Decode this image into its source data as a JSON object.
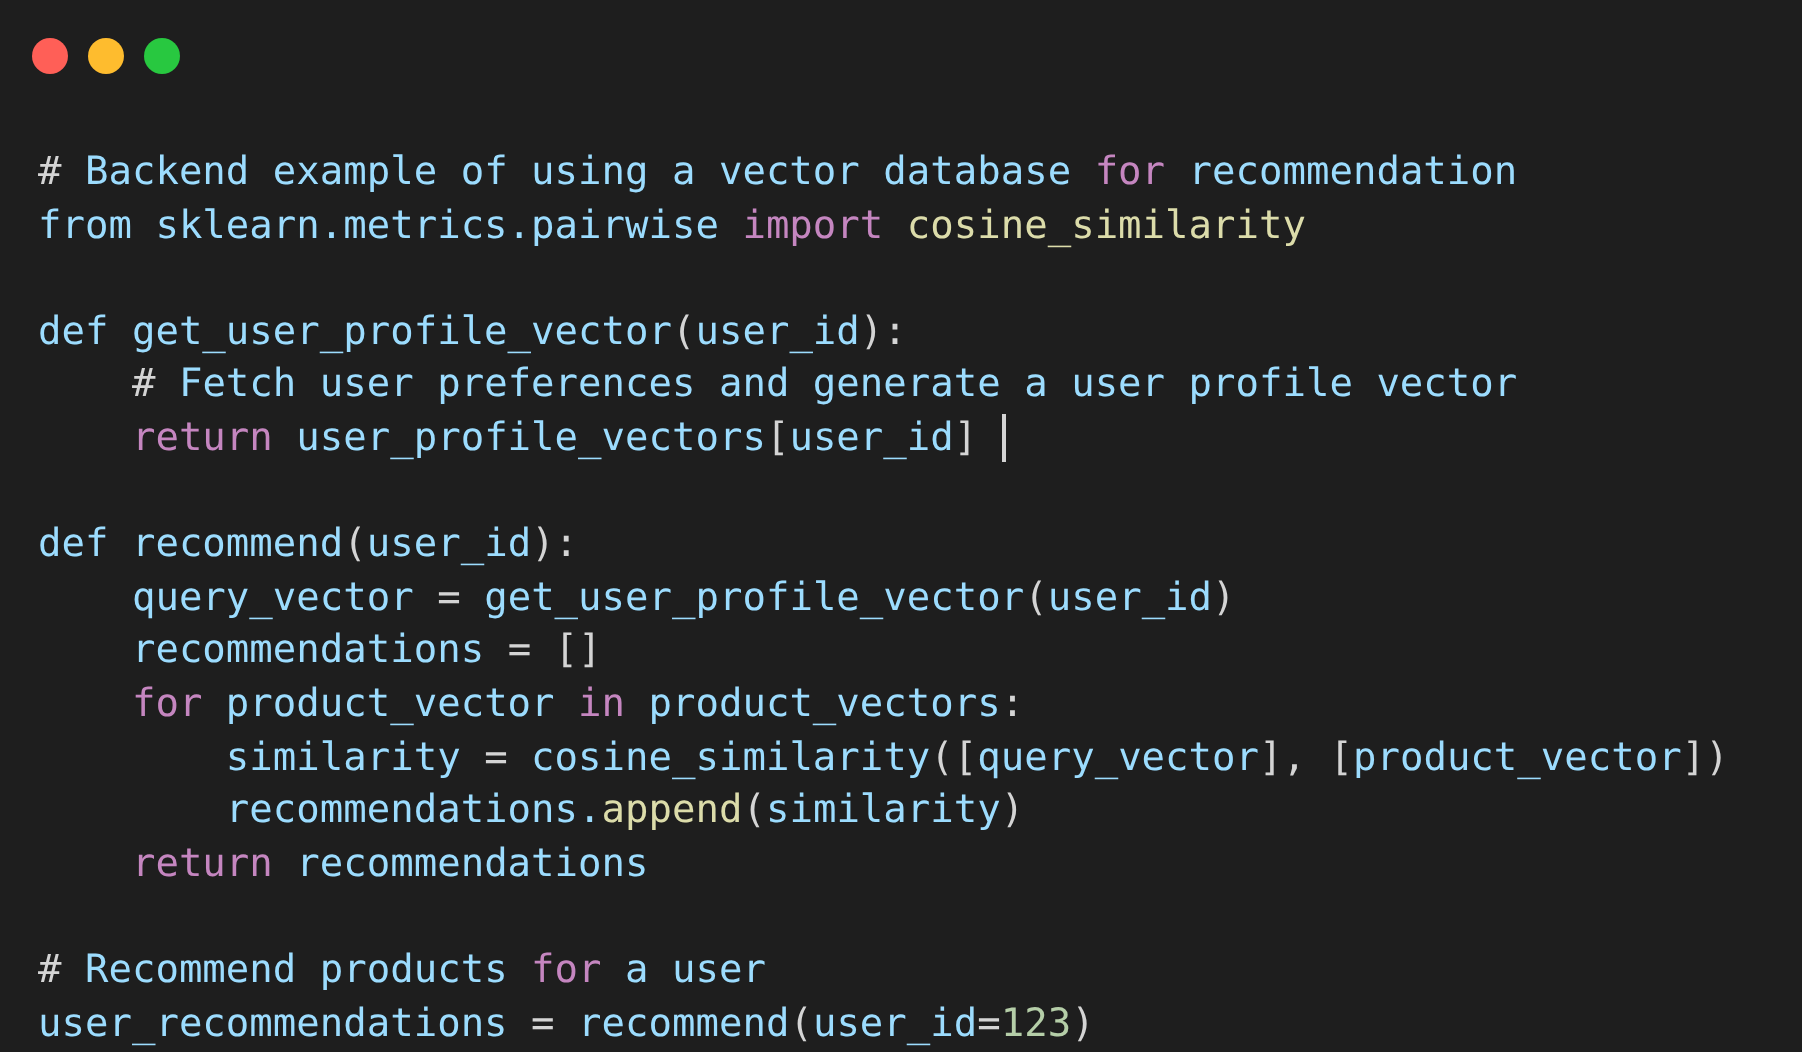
{
  "window_controls": [
    {
      "kind": "close"
    },
    {
      "kind": "minimize"
    },
    {
      "kind": "maximize"
    }
  ],
  "code_lines": [
    {
      "kind": "code",
      "tokens": [
        {
          "kind": "punct",
          "text": "# "
        },
        {
          "kind": "plain",
          "text": "Backend example of using a vector database "
        },
        {
          "kind": "keyword",
          "text": "for"
        },
        {
          "kind": "plain",
          "text": " recommendation"
        }
      ]
    },
    {
      "kind": "code",
      "tokens": [
        {
          "kind": "plain",
          "text": "from sklearn.metrics.pairwise "
        },
        {
          "kind": "keyword",
          "text": "import"
        },
        {
          "kind": "func",
          "text": " cosine_similarity"
        }
      ]
    },
    {
      "kind": "blank"
    },
    {
      "kind": "code",
      "tokens": [
        {
          "kind": "plain",
          "text": "def get_user_profile_vector"
        },
        {
          "kind": "punct",
          "text": "("
        },
        {
          "kind": "plain",
          "text": "user_id"
        },
        {
          "kind": "punct",
          "text": "):"
        }
      ]
    },
    {
      "kind": "code",
      "tokens": [
        {
          "kind": "punct",
          "text": "    # "
        },
        {
          "kind": "plain",
          "text": "Fetch user preferences and generate a user profile vector"
        }
      ]
    },
    {
      "kind": "code",
      "cursor": true,
      "tokens": [
        {
          "kind": "keyword",
          "text": "    return"
        },
        {
          "kind": "plain",
          "text": " user_profile_vectors"
        },
        {
          "kind": "punct",
          "text": "["
        },
        {
          "kind": "plain",
          "text": "user_id"
        },
        {
          "kind": "punct",
          "text": "]"
        }
      ]
    },
    {
      "kind": "blank"
    },
    {
      "kind": "code",
      "tokens": [
        {
          "kind": "plain",
          "text": "def recommend"
        },
        {
          "kind": "punct",
          "text": "("
        },
        {
          "kind": "plain",
          "text": "user_id"
        },
        {
          "kind": "punct",
          "text": "):"
        }
      ]
    },
    {
      "kind": "code",
      "tokens": [
        {
          "kind": "plain",
          "text": "    query_vector "
        },
        {
          "kind": "punct",
          "text": "="
        },
        {
          "kind": "plain",
          "text": " get_user_profile_vector"
        },
        {
          "kind": "punct",
          "text": "("
        },
        {
          "kind": "plain",
          "text": "user_id"
        },
        {
          "kind": "punct",
          "text": ")"
        }
      ]
    },
    {
      "kind": "code",
      "tokens": [
        {
          "kind": "plain",
          "text": "    recommendations "
        },
        {
          "kind": "punct",
          "text": "= []"
        }
      ]
    },
    {
      "kind": "code",
      "tokens": [
        {
          "kind": "keyword",
          "text": "    for"
        },
        {
          "kind": "plain",
          "text": " product_vector "
        },
        {
          "kind": "keyword",
          "text": "in"
        },
        {
          "kind": "plain",
          "text": " product_vectors"
        },
        {
          "kind": "punct",
          "text": ":"
        }
      ]
    },
    {
      "kind": "code",
      "tokens": [
        {
          "kind": "plain",
          "text": "        similarity "
        },
        {
          "kind": "punct",
          "text": "="
        },
        {
          "kind": "plain",
          "text": " cosine_similarity"
        },
        {
          "kind": "punct",
          "text": "(["
        },
        {
          "kind": "plain",
          "text": "query_vector"
        },
        {
          "kind": "punct",
          "text": "], ["
        },
        {
          "kind": "plain",
          "text": "product_vector"
        },
        {
          "kind": "punct",
          "text": "])"
        }
      ]
    },
    {
      "kind": "code",
      "tokens": [
        {
          "kind": "plain",
          "text": "        recommendations."
        },
        {
          "kind": "func",
          "text": "append"
        },
        {
          "kind": "punct",
          "text": "("
        },
        {
          "kind": "plain",
          "text": "similarity"
        },
        {
          "kind": "punct",
          "text": ")"
        }
      ]
    },
    {
      "kind": "code",
      "tokens": [
        {
          "kind": "keyword",
          "text": "    return"
        },
        {
          "kind": "plain",
          "text": " recommendations"
        }
      ]
    },
    {
      "kind": "blank"
    },
    {
      "kind": "code",
      "tokens": [
        {
          "kind": "punct",
          "text": "# "
        },
        {
          "kind": "plain",
          "text": "Recommend products "
        },
        {
          "kind": "keyword",
          "text": "for"
        },
        {
          "kind": "plain",
          "text": " a user"
        }
      ]
    },
    {
      "kind": "code",
      "tokens": [
        {
          "kind": "plain",
          "text": "user_recommendations "
        },
        {
          "kind": "punct",
          "text": "="
        },
        {
          "kind": "plain",
          "text": " recommend"
        },
        {
          "kind": "punct",
          "text": "("
        },
        {
          "kind": "plain",
          "text": "user_id"
        },
        {
          "kind": "punct",
          "text": "="
        },
        {
          "kind": "number",
          "text": "123"
        },
        {
          "kind": "punct",
          "text": ")"
        }
      ]
    }
  ]
}
